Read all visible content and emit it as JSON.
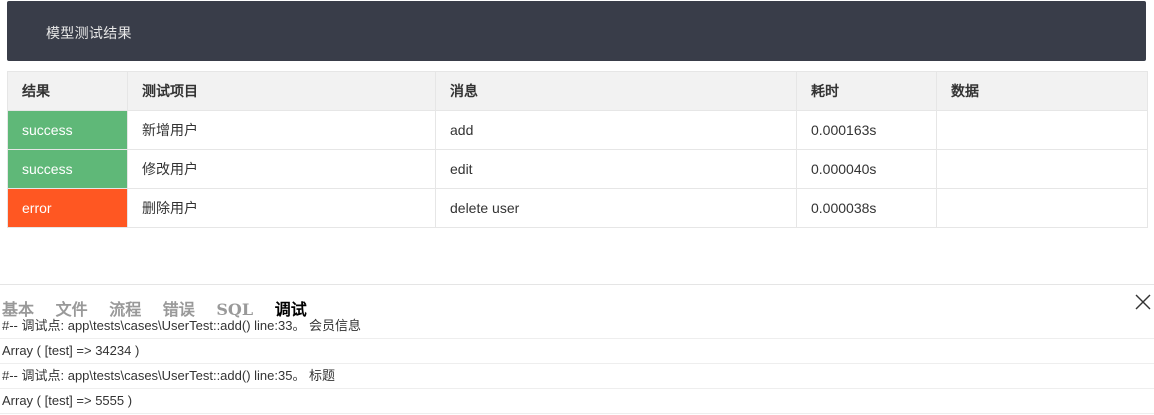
{
  "header": {
    "title": "模型测试结果"
  },
  "table": {
    "columns": [
      "结果",
      "测试项目",
      "消息",
      "耗时",
      "数据"
    ],
    "rows": [
      {
        "status": "success",
        "item": "新增用户",
        "message": "add",
        "time": "0.000163s",
        "data": ""
      },
      {
        "status": "success",
        "item": "修改用户",
        "message": "edit",
        "time": "0.000040s",
        "data": ""
      },
      {
        "status": "error",
        "item": "删除用户",
        "message": "delete user",
        "time": "0.000038s",
        "data": ""
      }
    ]
  },
  "colors": {
    "header_bg": "#393d49",
    "success": "#5fb878",
    "error": "#ff5722"
  },
  "trace": {
    "tabs": [
      "基本",
      "文件",
      "流程",
      "错误",
      "SQL",
      "调试"
    ],
    "active_tab": "调试",
    "close_icon": "close-icon",
    "lines": [
      "#-- 调试点: app\\tests\\cases\\UserTest::add() line:33。 会员信息",
      "Array ( [test] => 34234 )",
      "#-- 调试点: app\\tests\\cases\\UserTest::add() line:35。 标题",
      "Array ( [test] => 5555 )"
    ]
  }
}
